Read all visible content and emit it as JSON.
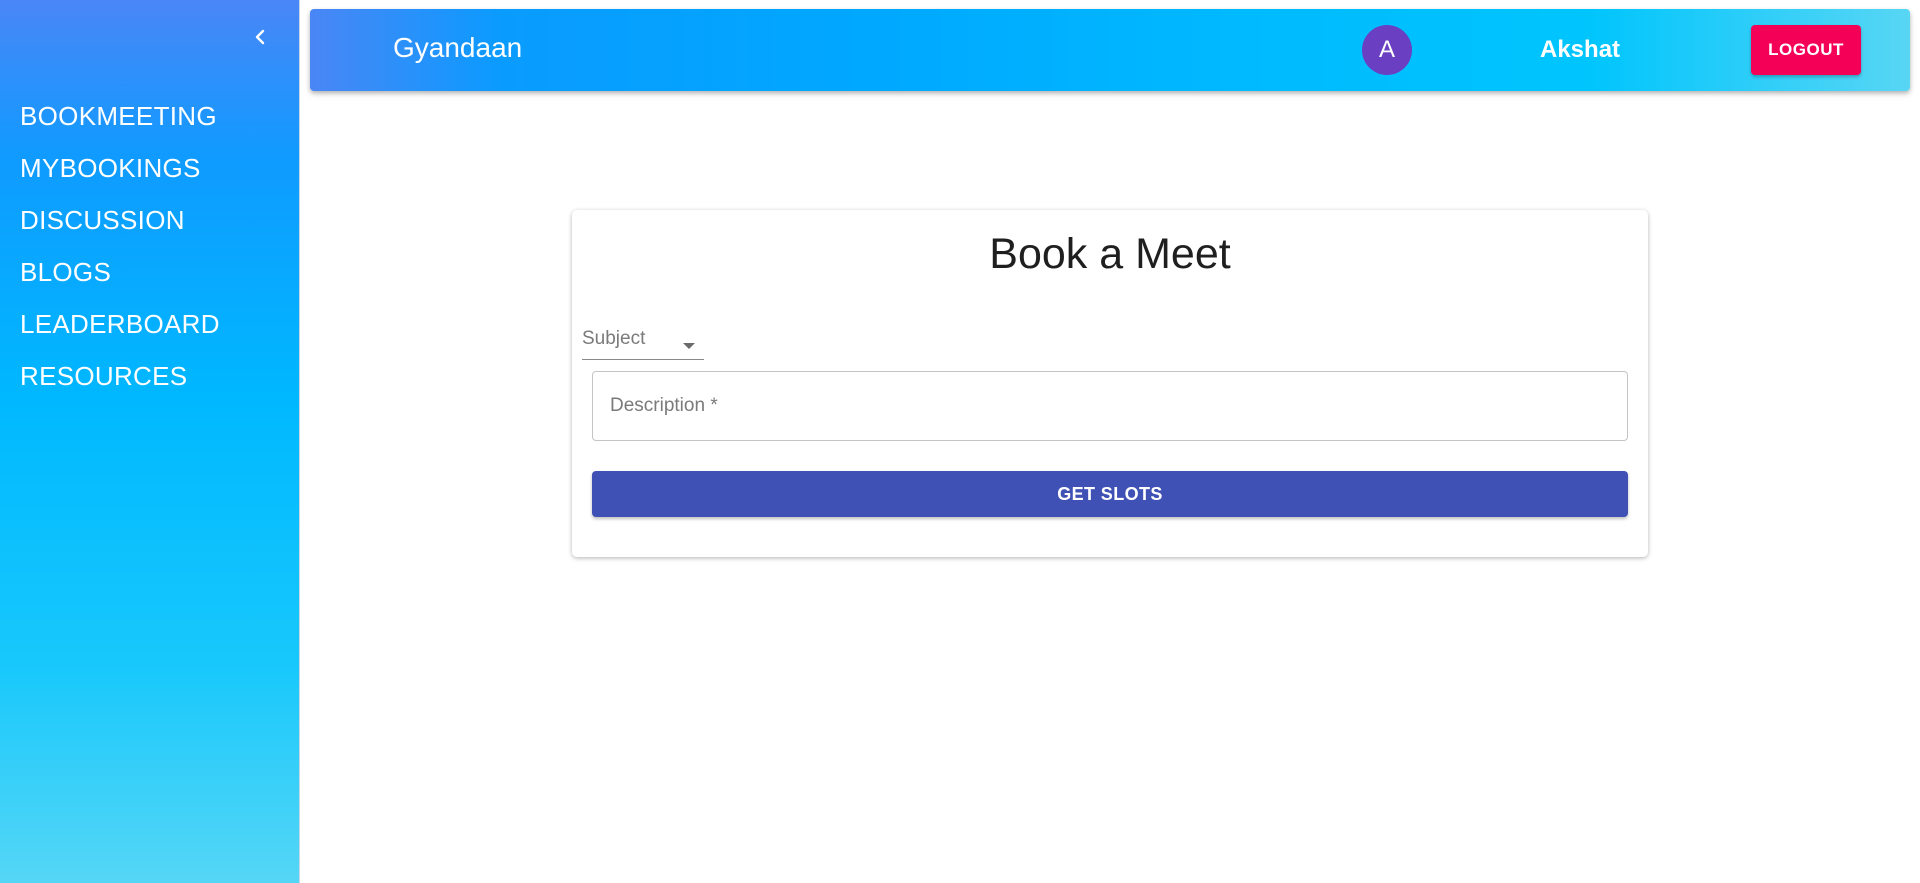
{
  "sidebar": {
    "collapse_icon": "chevron-left-icon",
    "items": [
      {
        "label": "BOOKMEETING"
      },
      {
        "label": "MYBOOKINGS"
      },
      {
        "label": "DISCUSSION"
      },
      {
        "label": "BLOGS"
      },
      {
        "label": "LEADERBOARD"
      },
      {
        "label": "RESOURCES"
      }
    ]
  },
  "header": {
    "brand": "Gyandaan",
    "avatar_initial": "A",
    "username": "Akshat",
    "logout_label": "LOGOUT"
  },
  "form": {
    "title": "Book a Meet",
    "subject_label": "Subject",
    "description_placeholder": "Description *",
    "description_value": "",
    "submit_label": "GET SLOTS"
  },
  "colors": {
    "accent": "#3f51b5",
    "logout": "#f50057",
    "avatar": "#6a3fc1",
    "gradient_start": "#4a86f7",
    "gradient_end": "#55d6f6"
  }
}
